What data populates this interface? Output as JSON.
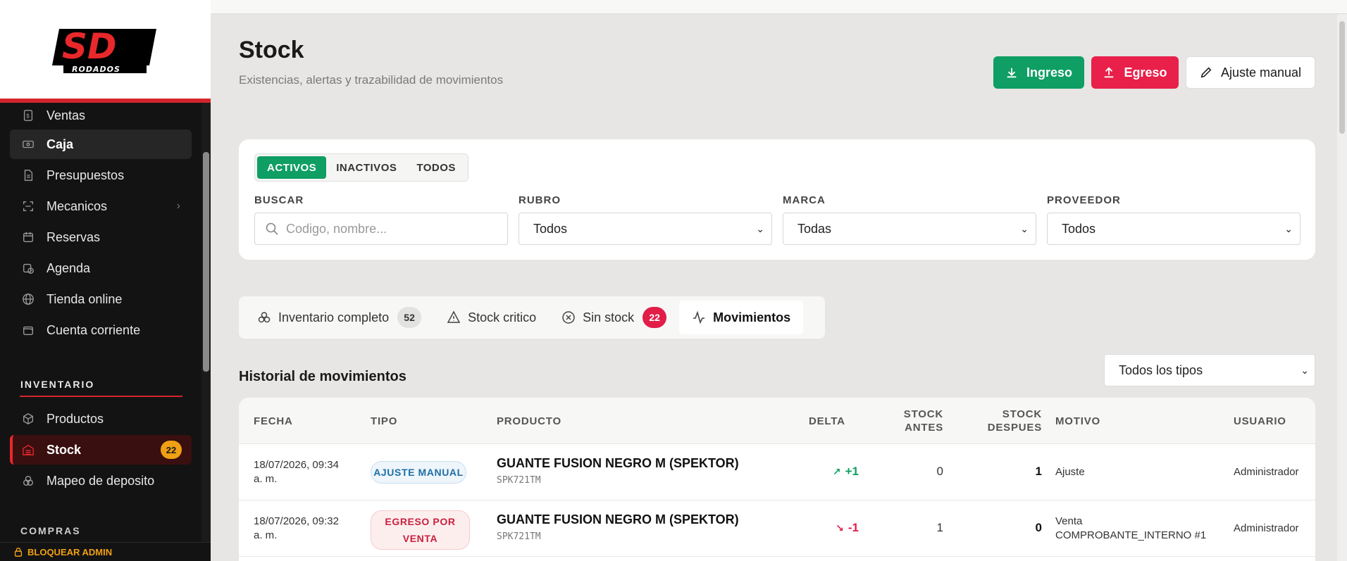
{
  "brand": {
    "logo_text": "SD",
    "logo_subtext": "RODADOS"
  },
  "sidebar": {
    "items": [
      {
        "label": "Ventas",
        "icon": "dollar-doc-icon"
      },
      {
        "label": "Caja",
        "icon": "cash-icon"
      },
      {
        "label": "Presupuestos",
        "icon": "document-icon"
      },
      {
        "label": "Mecanicos",
        "icon": "scan-icon"
      },
      {
        "label": "Reservas",
        "icon": "calendar-icon"
      },
      {
        "label": "Agenda",
        "icon": "calendar-clock-icon"
      },
      {
        "label": "Tienda online",
        "icon": "globe-icon"
      },
      {
        "label": "Cuenta corriente",
        "icon": "wallet-icon"
      }
    ],
    "section_inventario": "INVENTARIO",
    "inventario_items": [
      {
        "label": "Productos",
        "icon": "box-icon"
      },
      {
        "label": "Stock",
        "icon": "warehouse-icon",
        "badge": "22"
      },
      {
        "label": "Mapeo de deposito",
        "icon": "layers-icon"
      }
    ],
    "section_compras": "COMPRAS",
    "lock_label": "BLOQUEAR ADMIN"
  },
  "header": {
    "title": "Stock",
    "subtitle": "Existencias, alertas y trazabilidad de movimientos",
    "btn_ingreso": "Ingreso",
    "btn_egreso": "Egreso",
    "btn_ajuste": "Ajuste manual"
  },
  "filters": {
    "status_tabs": [
      "ACTIVOS",
      "INACTIVOS",
      "TODOS"
    ],
    "buscar_label": "BUSCAR",
    "buscar_placeholder": "Codigo, nombre...",
    "rubro_label": "RUBRO",
    "rubro_value": "Todos",
    "marca_label": "MARCA",
    "marca_value": "Todas",
    "proveedor_label": "PROVEEDOR",
    "proveedor_value": "Todos"
  },
  "tabs": {
    "inventario": "Inventario completo",
    "inventario_count": "52",
    "critico": "Stock critico",
    "sin_stock": "Sin stock",
    "sin_stock_count": "22",
    "movimientos": "Movimientos"
  },
  "history": {
    "title": "Historial de movimientos",
    "type_filter": "Todos los tipos",
    "columns": {
      "fecha": "FECHA",
      "tipo": "TIPO",
      "producto": "PRODUCTO",
      "delta": "DELTA",
      "stock_antes_1": "STOCK",
      "stock_antes_2": "ANTES",
      "stock_despues_1": "STOCK",
      "stock_despues_2": "DESPUES",
      "motivo": "MOTIVO",
      "usuario": "USUARIO"
    },
    "rows": [
      {
        "fecha_1": "18/07/2026, 09:34",
        "fecha_2": "a. m.",
        "tipo": "AJUSTE MANUAL",
        "producto": "GUANTE FUSION NEGRO M (SPEKTOR)",
        "sku": "SPK721TM",
        "delta": "+1",
        "antes": "0",
        "despues": "1",
        "motivo_1": "Ajuste",
        "motivo_2": "",
        "usuario": "Administrador"
      },
      {
        "fecha_1": "18/07/2026, 09:32",
        "fecha_2": "a. m.",
        "tipo_1": "EGRESO POR",
        "tipo_2": "VENTA",
        "producto": "GUANTE FUSION NEGRO M (SPEKTOR)",
        "sku": "SPK721TM",
        "delta": "-1",
        "antes": "1",
        "despues": "0",
        "motivo_1": "Venta",
        "motivo_2": "COMPROBANTE_INTERNO #1",
        "usuario": "Administrador"
      }
    ]
  },
  "colors": {
    "accent_green": "#0f9e63",
    "accent_red": "#e8204a",
    "sidebar_bg": "#131313",
    "badge_orange": "#f0a014"
  }
}
